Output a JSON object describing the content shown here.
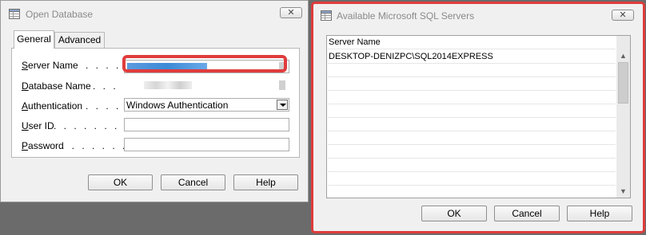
{
  "open_db": {
    "title": "Open Database",
    "close_label": "✕",
    "tabs": [
      {
        "label": "General"
      },
      {
        "label": "Advanced"
      }
    ],
    "fields": {
      "server_name": {
        "label_pre": "S",
        "label_post": "erver Name",
        "dots": ". . . . . . ."
      },
      "database_name": {
        "label_pre": "D",
        "label_post": "atabase Name",
        "dots": ". . . . ."
      },
      "authentication": {
        "label_pre": "A",
        "label_post": "uthentication",
        "dots": ". . . . .",
        "value": "Windows Authentication"
      },
      "user_id": {
        "label_pre": "U",
        "label_post": "ser ID",
        "dots": ". . . . . . . . . ."
      },
      "password": {
        "label_pre": "P",
        "label_post": "assword",
        "dots": ". . . . . . . . ."
      }
    },
    "buttons": {
      "ok": "OK",
      "cancel": "Cancel",
      "help": "Help"
    }
  },
  "servers": {
    "title": "Available Microsoft SQL Servers",
    "close_label": "✕",
    "column_header": "Server Name",
    "rows": [
      "DESKTOP-DENIZPC\\SQL2014EXPRESS"
    ],
    "buttons": {
      "ok": "OK",
      "cancel": "Cancel",
      "help": "Help"
    }
  },
  "colors": {
    "highlight": "#e03c3c",
    "blurred_selection": "#3c8ad6"
  }
}
